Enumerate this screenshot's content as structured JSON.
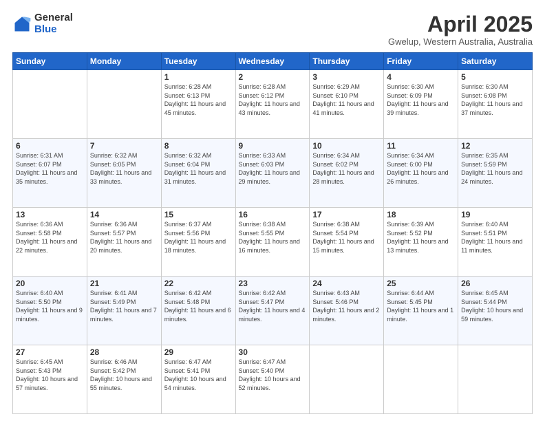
{
  "logo": {
    "general": "General",
    "blue": "Blue"
  },
  "header": {
    "title": "April 2025",
    "subtitle": "Gwelup, Western Australia, Australia"
  },
  "days_of_week": [
    "Sunday",
    "Monday",
    "Tuesday",
    "Wednesday",
    "Thursday",
    "Friday",
    "Saturday"
  ],
  "weeks": [
    [
      {
        "day": "",
        "sunrise": "",
        "sunset": "",
        "daylight": ""
      },
      {
        "day": "",
        "sunrise": "",
        "sunset": "",
        "daylight": ""
      },
      {
        "day": "1",
        "sunrise": "Sunrise: 6:28 AM",
        "sunset": "Sunset: 6:13 PM",
        "daylight": "Daylight: 11 hours and 45 minutes."
      },
      {
        "day": "2",
        "sunrise": "Sunrise: 6:28 AM",
        "sunset": "Sunset: 6:12 PM",
        "daylight": "Daylight: 11 hours and 43 minutes."
      },
      {
        "day": "3",
        "sunrise": "Sunrise: 6:29 AM",
        "sunset": "Sunset: 6:10 PM",
        "daylight": "Daylight: 11 hours and 41 minutes."
      },
      {
        "day": "4",
        "sunrise": "Sunrise: 6:30 AM",
        "sunset": "Sunset: 6:09 PM",
        "daylight": "Daylight: 11 hours and 39 minutes."
      },
      {
        "day": "5",
        "sunrise": "Sunrise: 6:30 AM",
        "sunset": "Sunset: 6:08 PM",
        "daylight": "Daylight: 11 hours and 37 minutes."
      }
    ],
    [
      {
        "day": "6",
        "sunrise": "Sunrise: 6:31 AM",
        "sunset": "Sunset: 6:07 PM",
        "daylight": "Daylight: 11 hours and 35 minutes."
      },
      {
        "day": "7",
        "sunrise": "Sunrise: 6:32 AM",
        "sunset": "Sunset: 6:05 PM",
        "daylight": "Daylight: 11 hours and 33 minutes."
      },
      {
        "day": "8",
        "sunrise": "Sunrise: 6:32 AM",
        "sunset": "Sunset: 6:04 PM",
        "daylight": "Daylight: 11 hours and 31 minutes."
      },
      {
        "day": "9",
        "sunrise": "Sunrise: 6:33 AM",
        "sunset": "Sunset: 6:03 PM",
        "daylight": "Daylight: 11 hours and 29 minutes."
      },
      {
        "day": "10",
        "sunrise": "Sunrise: 6:34 AM",
        "sunset": "Sunset: 6:02 PM",
        "daylight": "Daylight: 11 hours and 28 minutes."
      },
      {
        "day": "11",
        "sunrise": "Sunrise: 6:34 AM",
        "sunset": "Sunset: 6:00 PM",
        "daylight": "Daylight: 11 hours and 26 minutes."
      },
      {
        "day": "12",
        "sunrise": "Sunrise: 6:35 AM",
        "sunset": "Sunset: 5:59 PM",
        "daylight": "Daylight: 11 hours and 24 minutes."
      }
    ],
    [
      {
        "day": "13",
        "sunrise": "Sunrise: 6:36 AM",
        "sunset": "Sunset: 5:58 PM",
        "daylight": "Daylight: 11 hours and 22 minutes."
      },
      {
        "day": "14",
        "sunrise": "Sunrise: 6:36 AM",
        "sunset": "Sunset: 5:57 PM",
        "daylight": "Daylight: 11 hours and 20 minutes."
      },
      {
        "day": "15",
        "sunrise": "Sunrise: 6:37 AM",
        "sunset": "Sunset: 5:56 PM",
        "daylight": "Daylight: 11 hours and 18 minutes."
      },
      {
        "day": "16",
        "sunrise": "Sunrise: 6:38 AM",
        "sunset": "Sunset: 5:55 PM",
        "daylight": "Daylight: 11 hours and 16 minutes."
      },
      {
        "day": "17",
        "sunrise": "Sunrise: 6:38 AM",
        "sunset": "Sunset: 5:54 PM",
        "daylight": "Daylight: 11 hours and 15 minutes."
      },
      {
        "day": "18",
        "sunrise": "Sunrise: 6:39 AM",
        "sunset": "Sunset: 5:52 PM",
        "daylight": "Daylight: 11 hours and 13 minutes."
      },
      {
        "day": "19",
        "sunrise": "Sunrise: 6:40 AM",
        "sunset": "Sunset: 5:51 PM",
        "daylight": "Daylight: 11 hours and 11 minutes."
      }
    ],
    [
      {
        "day": "20",
        "sunrise": "Sunrise: 6:40 AM",
        "sunset": "Sunset: 5:50 PM",
        "daylight": "Daylight: 11 hours and 9 minutes."
      },
      {
        "day": "21",
        "sunrise": "Sunrise: 6:41 AM",
        "sunset": "Sunset: 5:49 PM",
        "daylight": "Daylight: 11 hours and 7 minutes."
      },
      {
        "day": "22",
        "sunrise": "Sunrise: 6:42 AM",
        "sunset": "Sunset: 5:48 PM",
        "daylight": "Daylight: 11 hours and 6 minutes."
      },
      {
        "day": "23",
        "sunrise": "Sunrise: 6:42 AM",
        "sunset": "Sunset: 5:47 PM",
        "daylight": "Daylight: 11 hours and 4 minutes."
      },
      {
        "day": "24",
        "sunrise": "Sunrise: 6:43 AM",
        "sunset": "Sunset: 5:46 PM",
        "daylight": "Daylight: 11 hours and 2 minutes."
      },
      {
        "day": "25",
        "sunrise": "Sunrise: 6:44 AM",
        "sunset": "Sunset: 5:45 PM",
        "daylight": "Daylight: 11 hours and 1 minute."
      },
      {
        "day": "26",
        "sunrise": "Sunrise: 6:45 AM",
        "sunset": "Sunset: 5:44 PM",
        "daylight": "Daylight: 10 hours and 59 minutes."
      }
    ],
    [
      {
        "day": "27",
        "sunrise": "Sunrise: 6:45 AM",
        "sunset": "Sunset: 5:43 PM",
        "daylight": "Daylight: 10 hours and 57 minutes."
      },
      {
        "day": "28",
        "sunrise": "Sunrise: 6:46 AM",
        "sunset": "Sunset: 5:42 PM",
        "daylight": "Daylight: 10 hours and 55 minutes."
      },
      {
        "day": "29",
        "sunrise": "Sunrise: 6:47 AM",
        "sunset": "Sunset: 5:41 PM",
        "daylight": "Daylight: 10 hours and 54 minutes."
      },
      {
        "day": "30",
        "sunrise": "Sunrise: 6:47 AM",
        "sunset": "Sunset: 5:40 PM",
        "daylight": "Daylight: 10 hours and 52 minutes."
      },
      {
        "day": "",
        "sunrise": "",
        "sunset": "",
        "daylight": ""
      },
      {
        "day": "",
        "sunrise": "",
        "sunset": "",
        "daylight": ""
      },
      {
        "day": "",
        "sunrise": "",
        "sunset": "",
        "daylight": ""
      }
    ]
  ]
}
